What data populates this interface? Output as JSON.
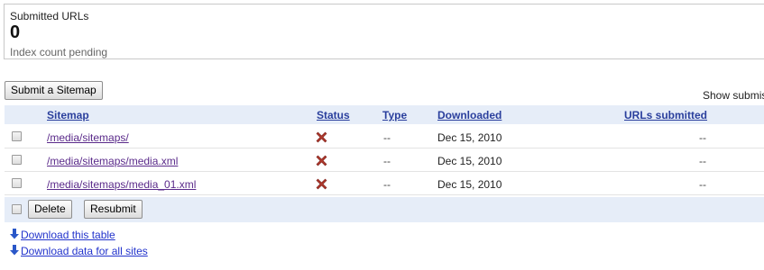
{
  "summary": {
    "title": "Submitted URLs",
    "count": "0",
    "note": "Index count pending"
  },
  "toolbar": {
    "submit_label": "Submit a Sitemap",
    "show_submitted_label": "Show submis"
  },
  "table": {
    "headers": {
      "sitemap": "Sitemap",
      "status": "Status",
      "type": "Type",
      "downloaded": "Downloaded",
      "urls_submitted": "URLs submitted"
    },
    "rows": [
      {
        "sitemap": "/media/sitemaps/",
        "status_icon": "error-x-icon",
        "type": "--",
        "downloaded": "Dec 15, 2010",
        "urls_submitted": "--"
      },
      {
        "sitemap": "/media/sitemaps/media.xml",
        "status_icon": "error-x-icon",
        "type": "--",
        "downloaded": "Dec 15, 2010",
        "urls_submitted": "--"
      },
      {
        "sitemap": "/media/sitemaps/media_01.xml",
        "status_icon": "error-x-icon",
        "type": "--",
        "downloaded": "Dec 15, 2010",
        "urls_submitted": "--"
      }
    ]
  },
  "actions": {
    "delete_label": "Delete",
    "resubmit_label": "Resubmit"
  },
  "downloads": {
    "table_link": "Download this table",
    "all_sites_link": "Download data for all sites"
  },
  "colors": {
    "header_bg": "#e6edf8",
    "header_link": "#2a3f9d",
    "visited_link": "#5a2a8a",
    "link": "#2233cc",
    "error_icon": "#b03a2e"
  }
}
